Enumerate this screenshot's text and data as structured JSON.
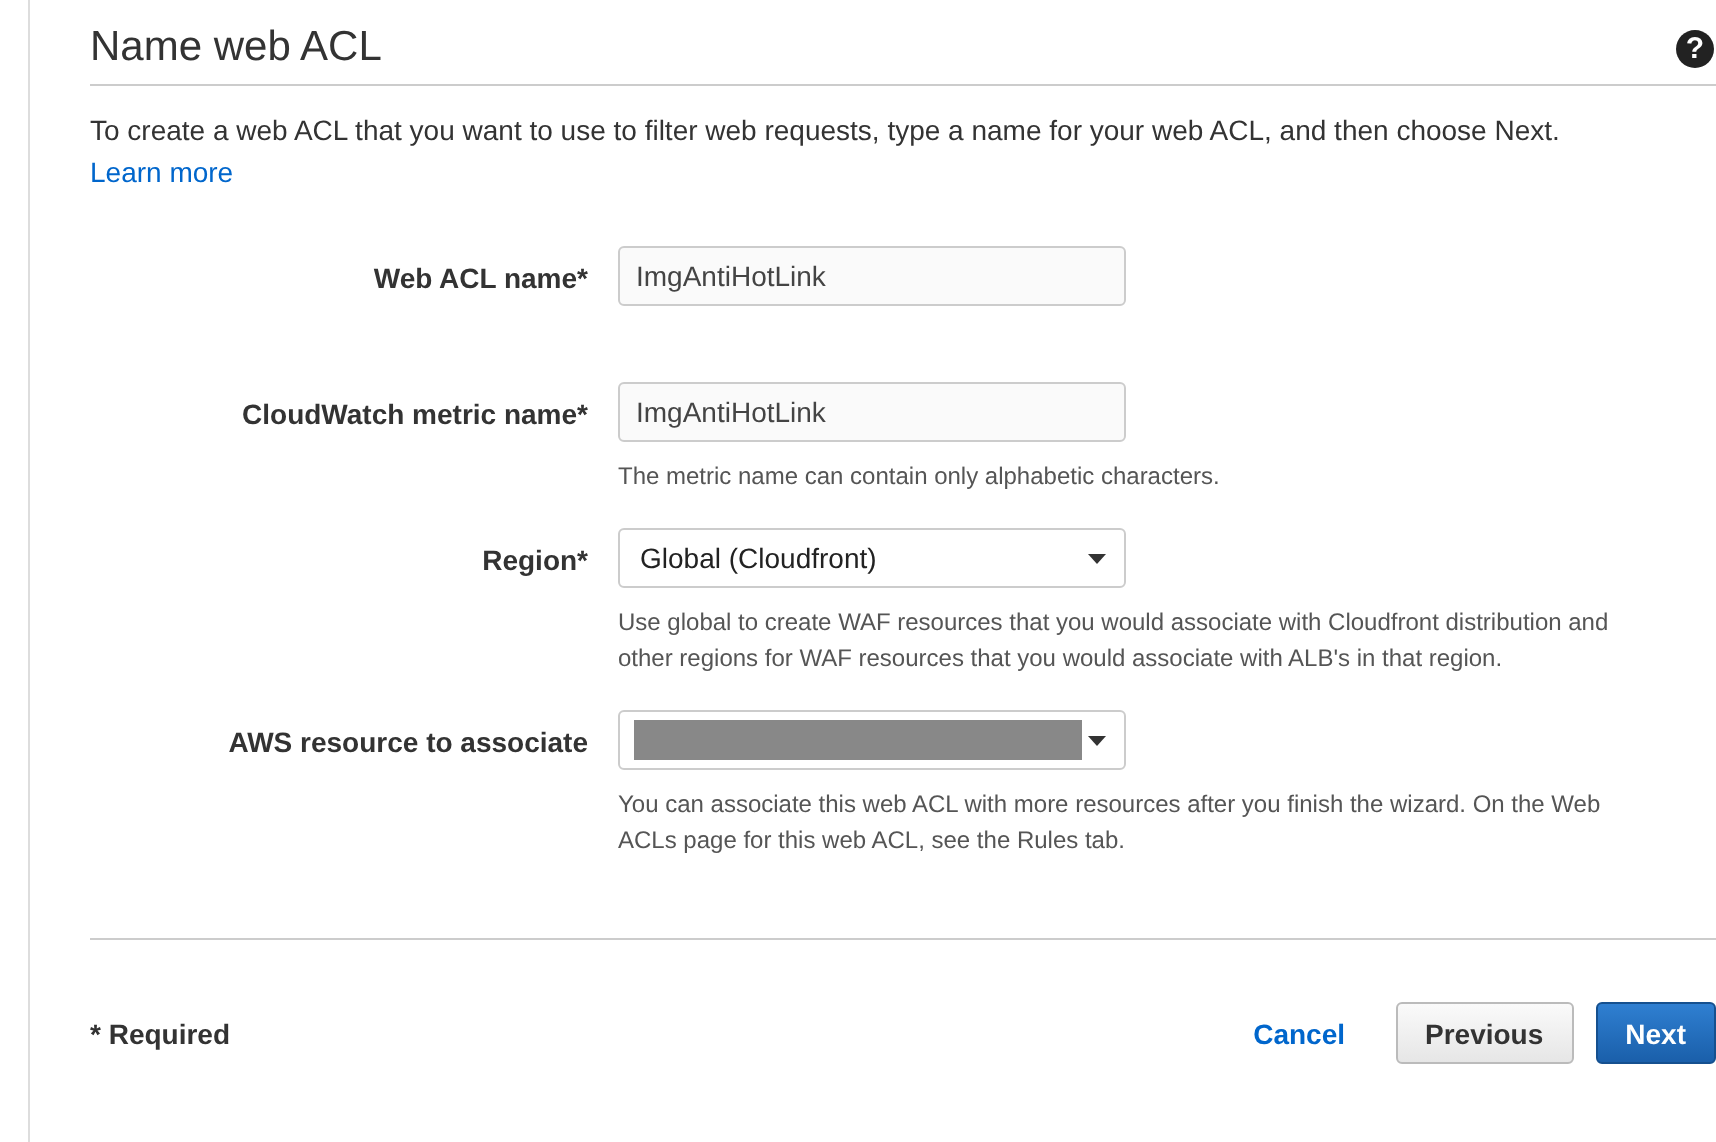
{
  "title": "Name web ACL",
  "help_icon": "?",
  "intro": {
    "text": "To create a web ACL that you want to use to filter web requests, type a name for your web ACL, and then choose Next.",
    "link": "Learn more"
  },
  "fields": [
    {
      "kind": "text",
      "label": "Web ACL name*",
      "value": "ImgAntiHotLink"
    },
    {
      "kind": "text",
      "label": "CloudWatch metric name*",
      "value": "ImgAntiHotLink",
      "hint": "The metric name can contain only alphabetic characters."
    },
    {
      "kind": "select",
      "label": "Region*",
      "value": "Global (Cloudfront)",
      "hint": "Use global to create WAF resources that you would associate with Cloudfront distribution and other regions for WAF resources that you would associate with ALB's in that region."
    },
    {
      "kind": "redacted-select",
      "label": "AWS resource to associate",
      "hint": "You can associate this web ACL with more resources after you finish the wizard. On the Web ACLs page for this web ACL, see the Rules tab."
    }
  ],
  "footer": {
    "required_note": "* Required",
    "buttons": [
      {
        "kind": "link",
        "label": "Cancel"
      },
      {
        "kind": "secondary",
        "label": "Previous"
      },
      {
        "kind": "primary",
        "label": "Next"
      }
    ]
  }
}
